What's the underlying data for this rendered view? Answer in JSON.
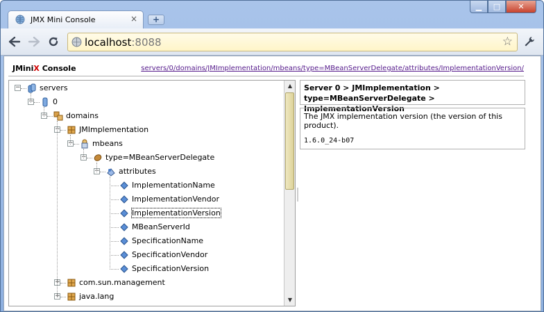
{
  "window": {
    "tab_title": "JMX Mini Console",
    "tab_close": "×",
    "new_tab": "+",
    "controls": {
      "minimize": "▁",
      "maximize": "□",
      "close": "✕"
    }
  },
  "toolbar": {
    "url_host": "localhost",
    "url_port": ":8088",
    "back_icon": "arrow-left",
    "forward_icon": "arrow-right",
    "reload_icon": "reload",
    "star_icon": "star",
    "wrench_icon": "wrench"
  },
  "console": {
    "brand_prefix": "JMini",
    "brand_x": "X",
    "brand_suffix": " Console",
    "breadcrumb": "servers/0/domains/JMImplementation/mbeans/type=MBeanServerDelegate/attributes/ImplementationVersion/",
    "accent_color": "#d00000"
  },
  "tree": {
    "nodes": [
      {
        "label": "servers",
        "icon": "servers-icon",
        "expander": "−",
        "depth": 0
      },
      {
        "label": "0",
        "icon": "server-icon",
        "expander": "−",
        "depth": 1
      },
      {
        "label": "domains",
        "icon": "domains-icon",
        "expander": "−",
        "depth": 2
      },
      {
        "label": "JMImplementation",
        "icon": "domain-icon",
        "expander": "−",
        "depth": 3
      },
      {
        "label": "mbeans",
        "icon": "mbeans-icon",
        "expander": "−",
        "depth": 4
      },
      {
        "label": "type=MBeanServerDelegate",
        "icon": "mbean-icon",
        "expander": "−",
        "depth": 5
      },
      {
        "label": "attributes",
        "icon": "attributes-icon",
        "expander": "−",
        "depth": 6
      },
      {
        "label": "ImplementationName",
        "icon": "attribute-icon",
        "depth": 7
      },
      {
        "label": "ImplementationVendor",
        "icon": "attribute-icon",
        "depth": 7
      },
      {
        "label": "ImplementationVersion",
        "icon": "attribute-icon",
        "depth": 7,
        "selected": true
      },
      {
        "label": "MBeanServerId",
        "icon": "attribute-icon",
        "depth": 7
      },
      {
        "label": "SpecificationName",
        "icon": "attribute-icon",
        "depth": 7
      },
      {
        "label": "SpecificationVendor",
        "icon": "attribute-icon",
        "depth": 7
      },
      {
        "label": "SpecificationVersion",
        "icon": "attribute-icon",
        "depth": 7
      },
      {
        "label": "com.sun.management",
        "icon": "domain-icon",
        "expander": "+",
        "depth": 3
      },
      {
        "label": "java.lang",
        "icon": "domain-icon",
        "expander": "+",
        "depth": 3
      }
    ]
  },
  "detail": {
    "title": "Server 0 > JMImplementation > type=MBeanServerDelegate > ImplementationVersion",
    "description": "The JMX implementation version (the version of this product).",
    "value": "1.6.0_24-b07"
  }
}
